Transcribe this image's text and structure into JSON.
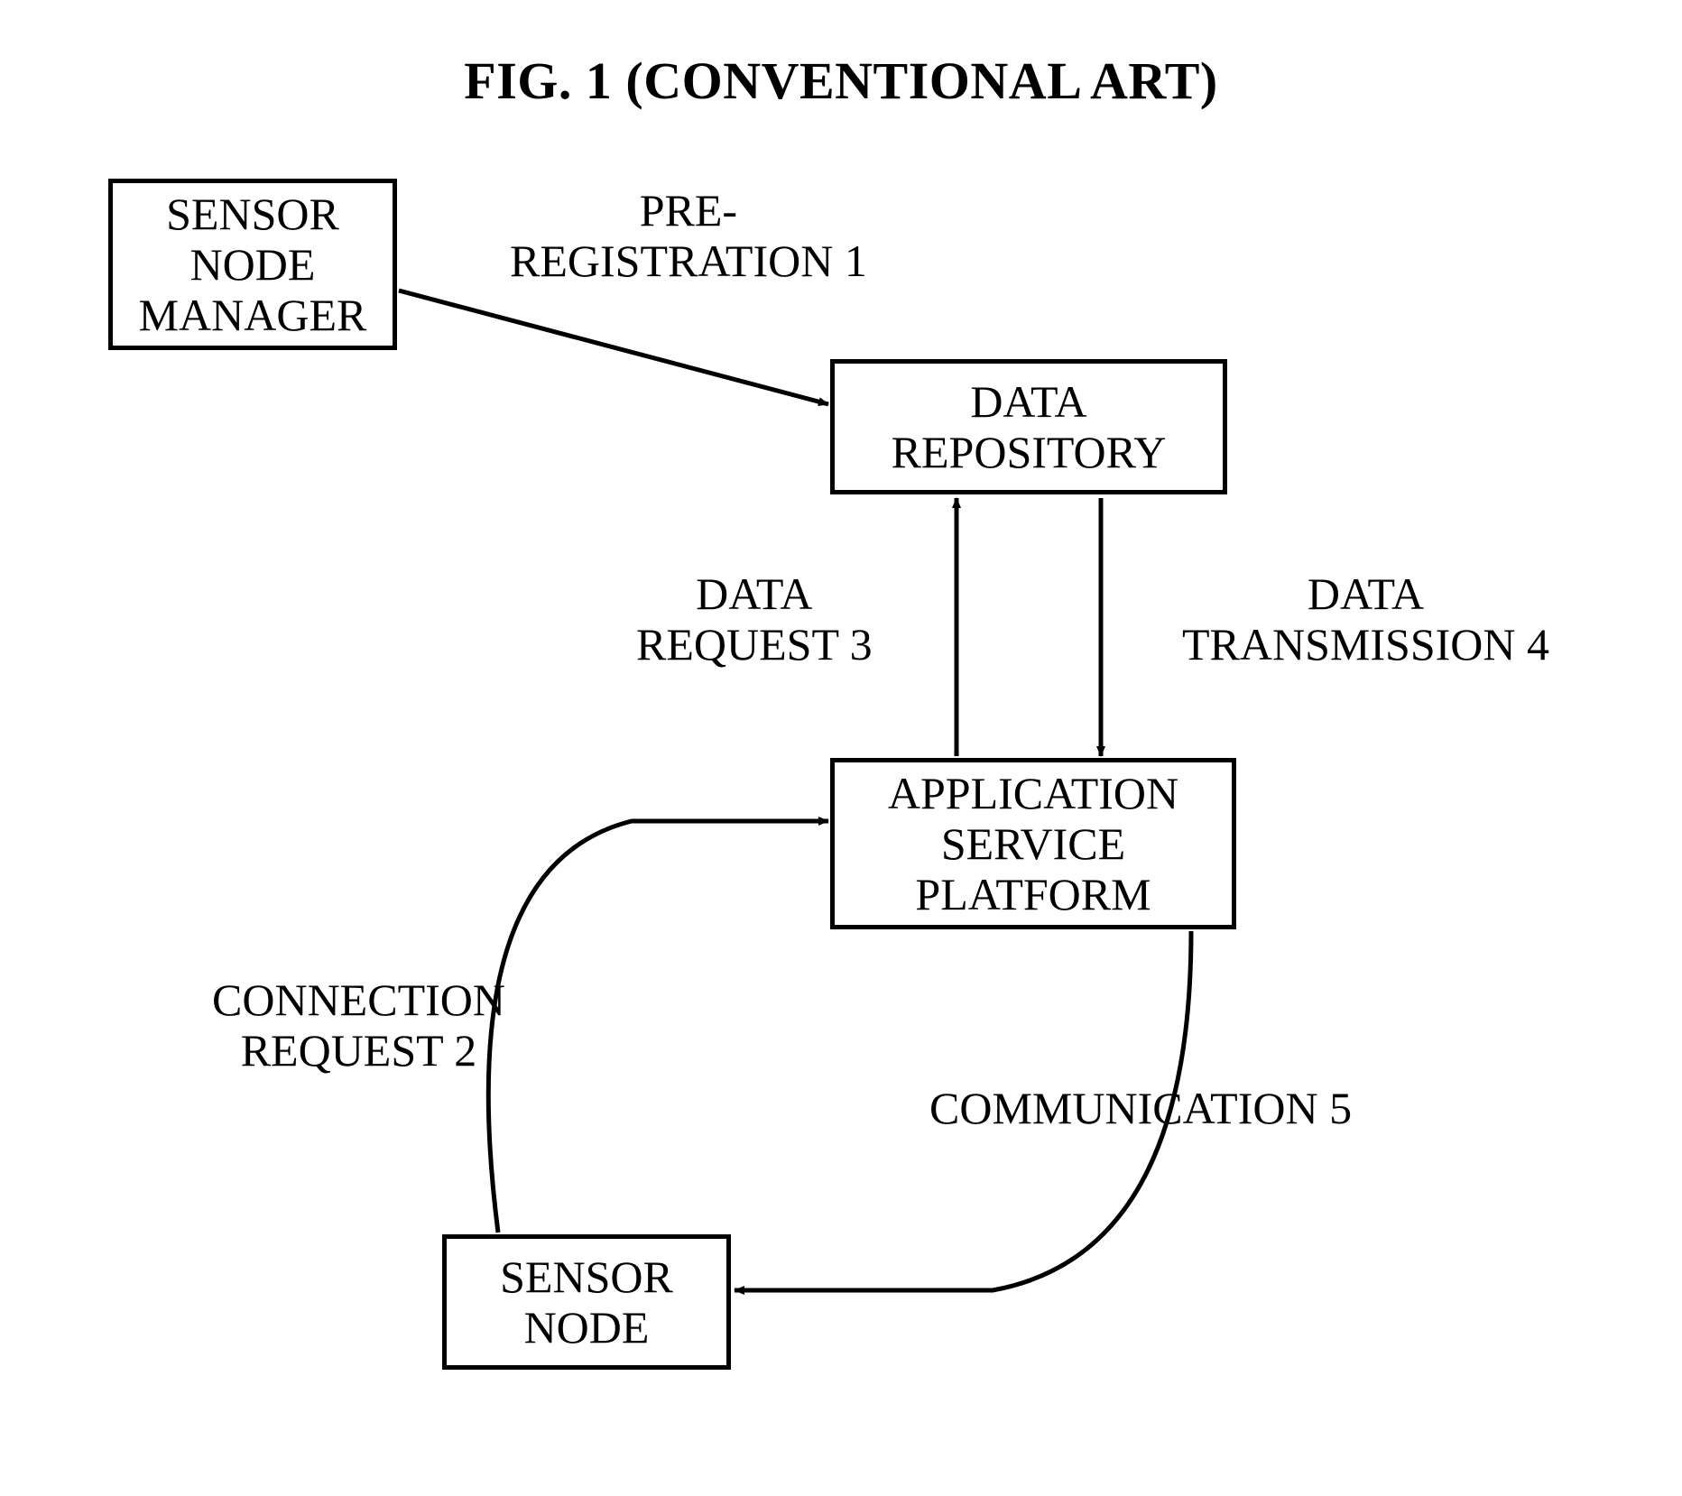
{
  "title": "FIG. 1 (CONVENTIONAL ART)",
  "boxes": {
    "sensor_node_manager": "SENSOR\nNODE\nMANAGER",
    "data_repository": "DATA\nREPOSITORY",
    "application_service_platform": "APPLICATION\nSERVICE\nPLATFORM",
    "sensor_node": "SENSOR\nNODE"
  },
  "labels": {
    "pre_registration": "PRE-\nREGISTRATION 1",
    "data_request": "DATA\nREQUEST 3",
    "data_transmission": "DATA\nTRANSMISSION 4",
    "connection_request": "CONNECTION\nREQUEST 2",
    "communication": "COMMUNICATION 5"
  }
}
